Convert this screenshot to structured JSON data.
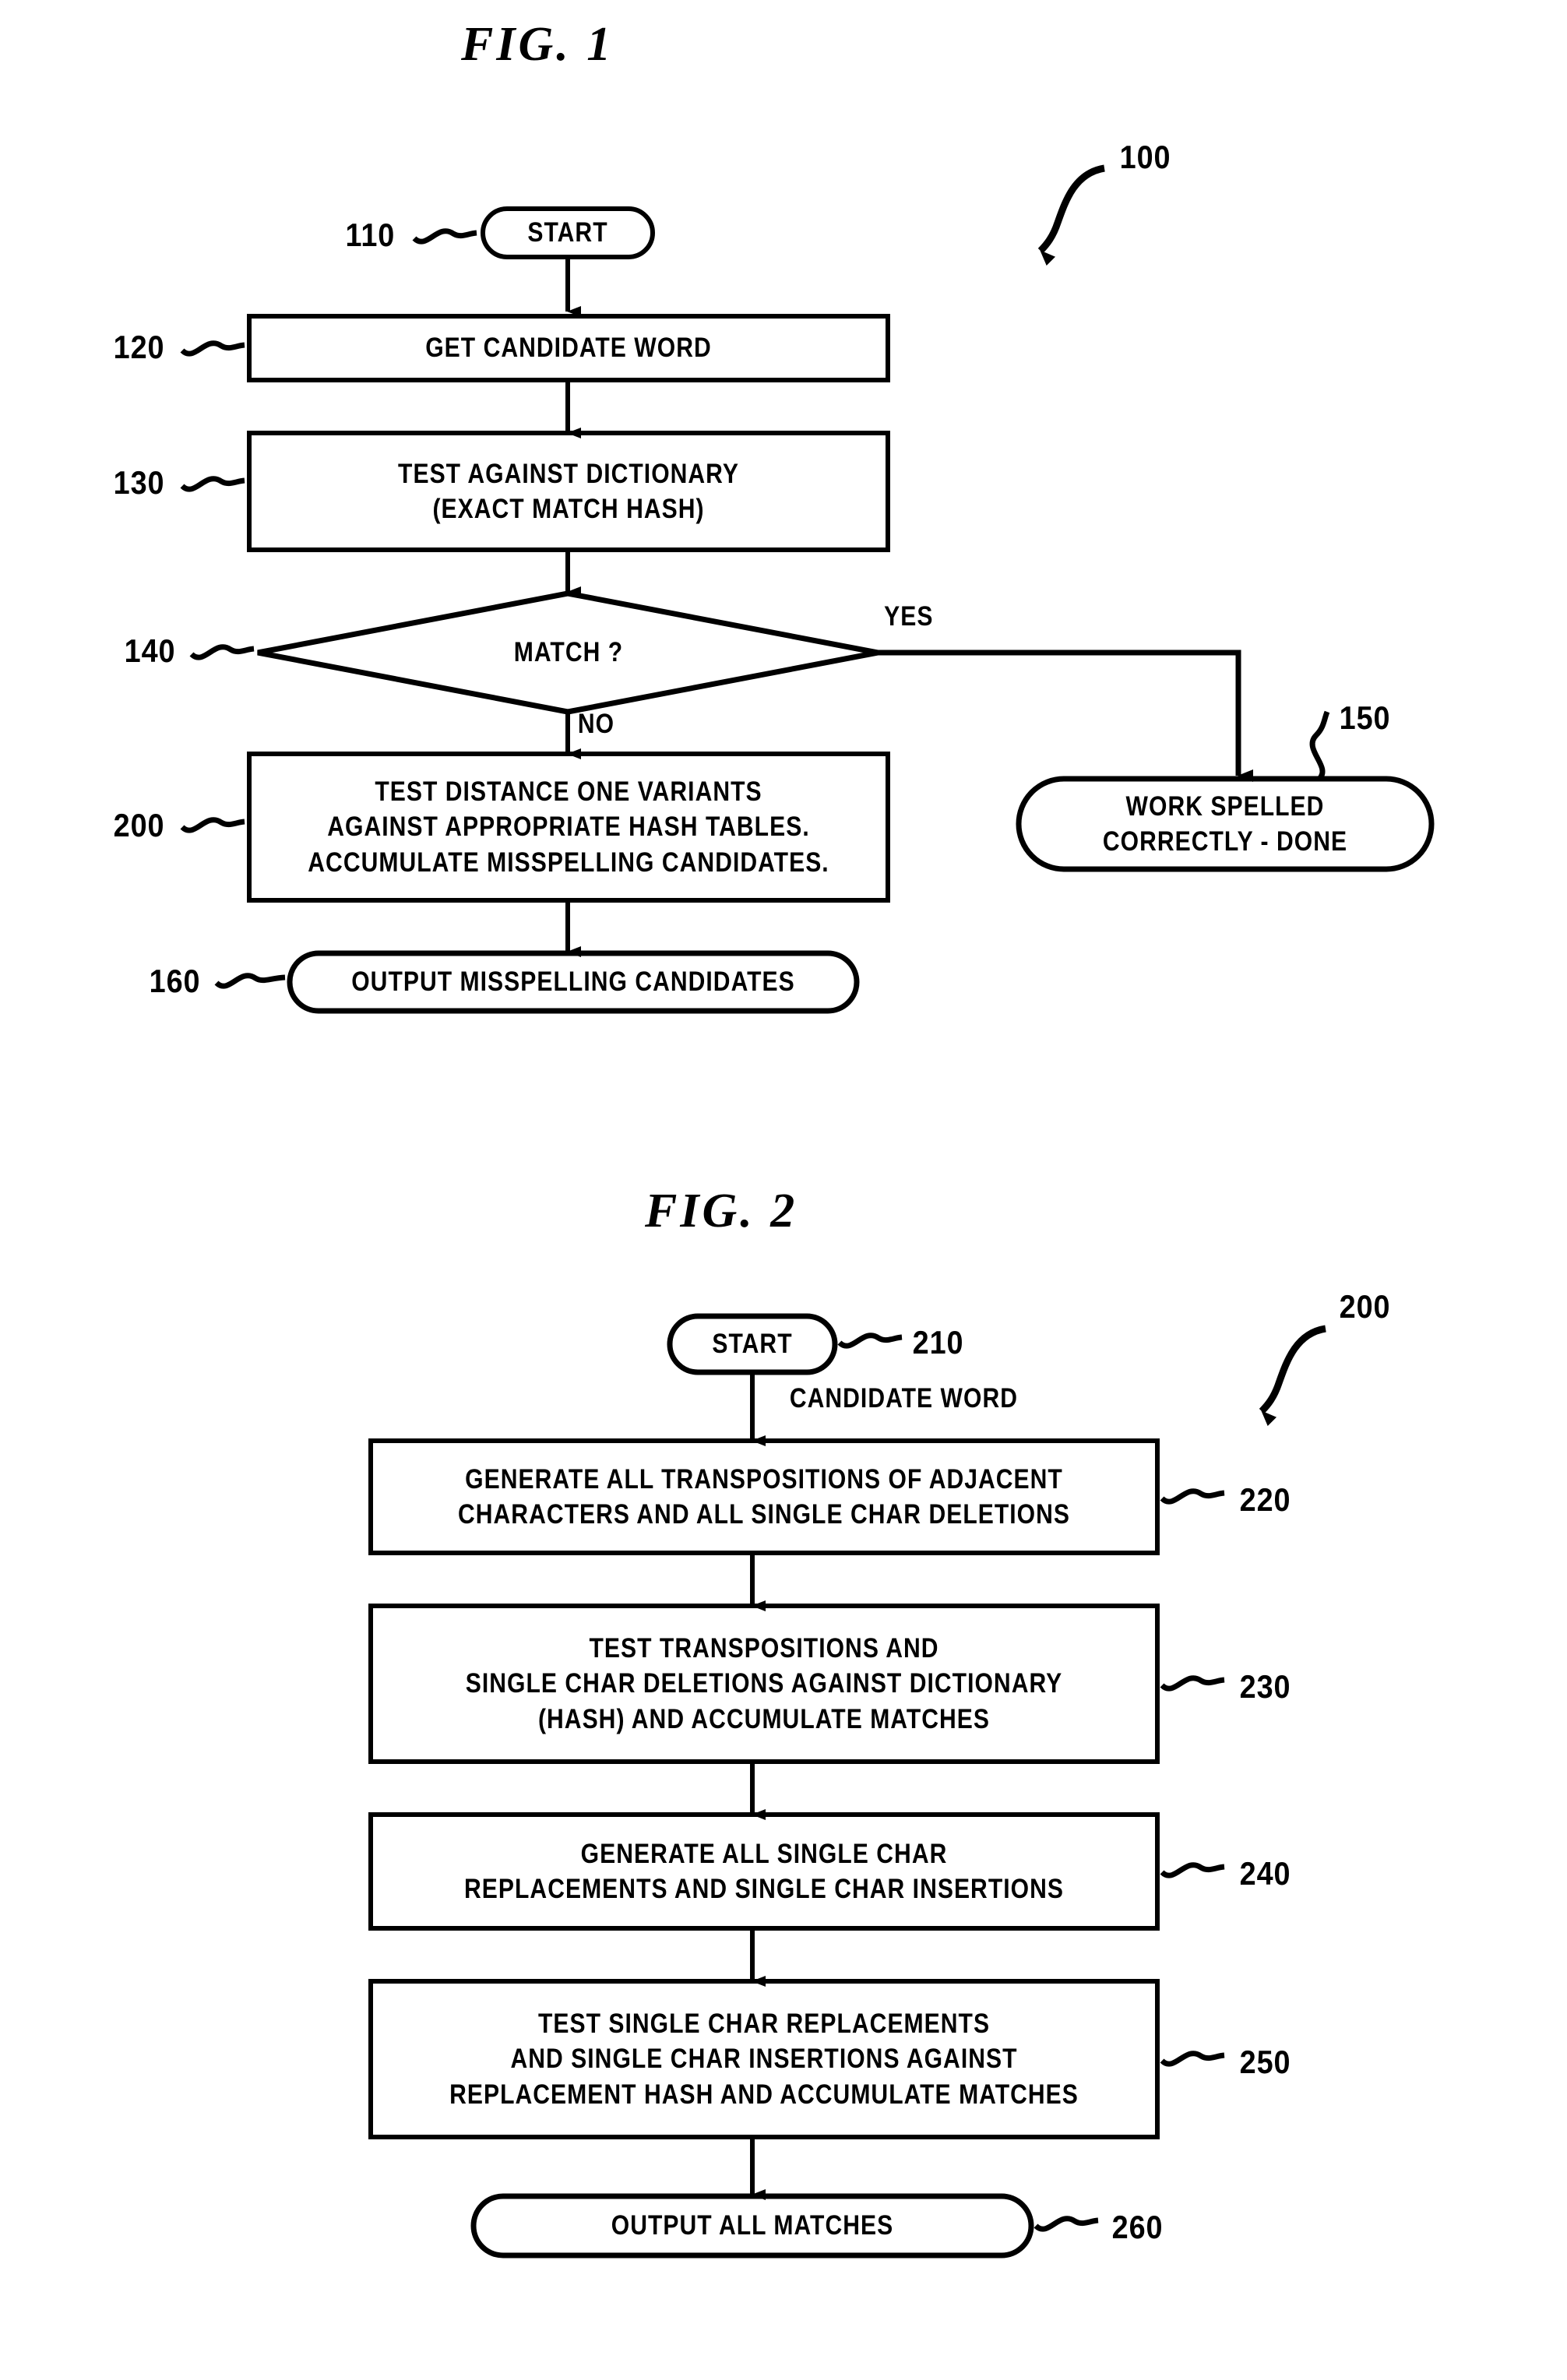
{
  "document": {
    "type": "patent-drawing-sheet",
    "background_color": "#ffffff",
    "ink_color": "#000000"
  },
  "figures": [
    {
      "id": "fig1",
      "title": "FIG.  1",
      "system_ref": "100",
      "nodes": [
        {
          "ref": "110",
          "shape": "terminator",
          "lines": [
            "START"
          ]
        },
        {
          "ref": "120",
          "shape": "process",
          "lines": [
            "GET CANDIDATE WORD"
          ]
        },
        {
          "ref": "130",
          "shape": "process",
          "lines": [
            "TEST AGAINST DICTIONARY",
            "(EXACT MATCH HASH)"
          ]
        },
        {
          "ref": "140",
          "shape": "decision",
          "lines": [
            "MATCH ?"
          ]
        },
        {
          "ref": "150",
          "shape": "terminator",
          "lines": [
            "WORK SPELLED",
            "CORRECTLY - DONE"
          ]
        },
        {
          "ref": "200",
          "shape": "process",
          "lines": [
            "TEST DISTANCE ONE VARIANTS",
            "AGAINST APPROPRIATE HASH TABLES.",
            "ACCUMULATE MISSPELLING CANDIDATES."
          ]
        },
        {
          "ref": "160",
          "shape": "terminator",
          "lines": [
            "OUTPUT MISSPELLING CANDIDATES"
          ]
        }
      ],
      "edge_labels": [
        {
          "name": "yes",
          "text": "YES"
        },
        {
          "name": "no",
          "text": "NO"
        }
      ]
    },
    {
      "id": "fig2",
      "title": "FIG.  2",
      "system_ref": "200",
      "nodes": [
        {
          "ref": "210",
          "shape": "terminator",
          "lines": [
            "START"
          ]
        },
        {
          "ref": "220",
          "shape": "process",
          "lines": [
            "GENERATE ALL TRANSPOSITIONS OF ADJACENT",
            "CHARACTERS AND ALL SINGLE CHAR DELETIONS"
          ]
        },
        {
          "ref": "230",
          "shape": "process",
          "lines": [
            "TEST TRANSPOSITIONS AND",
            "SINGLE CHAR DELETIONS AGAINST DICTIONARY",
            "(HASH) AND ACCUMULATE MATCHES"
          ]
        },
        {
          "ref": "240",
          "shape": "process",
          "lines": [
            "GENERATE ALL SINGLE CHAR",
            "REPLACEMENTS AND SINGLE CHAR INSERTIONS"
          ]
        },
        {
          "ref": "250",
          "shape": "process",
          "lines": [
            "TEST SINGLE CHAR REPLACEMENTS",
            "AND SINGLE CHAR INSERTIONS AGAINST",
            "REPLACEMENT HASH AND ACCUMULATE MATCHES"
          ]
        },
        {
          "ref": "260",
          "shape": "terminator",
          "lines": [
            "OUTPUT ALL MATCHES"
          ]
        }
      ],
      "edge_labels": [
        {
          "name": "candidate-word",
          "text": "CANDIDATE WORD"
        }
      ]
    }
  ]
}
